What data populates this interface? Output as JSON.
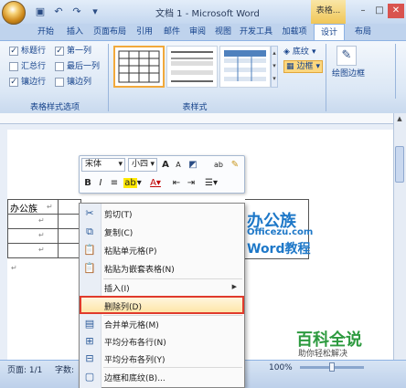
{
  "window": {
    "title": "文档 1 - Microsoft Word",
    "table_tools": "表格...",
    "minimize": "–",
    "maximize": "□",
    "close": "✕"
  },
  "tabs": [
    {
      "label": "开始"
    },
    {
      "label": "插入"
    },
    {
      "label": "页面布局"
    },
    {
      "label": "引用"
    },
    {
      "label": "邮件"
    },
    {
      "label": "审阅"
    },
    {
      "label": "视图"
    },
    {
      "label": "开发工具"
    },
    {
      "label": "加载项"
    },
    {
      "label": "设计"
    },
    {
      "label": "布局"
    }
  ],
  "ribbon": {
    "options": {
      "header_row": "标题行",
      "first_column": "第一列",
      "total_row": "汇总行",
      "last_column": "最后一列",
      "banded_rows": "镶边行",
      "banded_columns": "镶边列",
      "group_label": "表格样式选项"
    },
    "styles_group_label": "表样式",
    "shading": "底纹",
    "borders": "边框",
    "draw_borders": "绘图边框"
  },
  "document": {
    "cell_text": "办公族",
    "cell_mark": "↵",
    "para_mark": "↵"
  },
  "mini_toolbar": {
    "font": "宋体",
    "size": "小四",
    "grow": "A",
    "shrink": "A",
    "phonetic": "ab",
    "bold": "B",
    "italic": "I",
    "font_color": "A"
  },
  "context_menu": {
    "items": [
      {
        "label": "剪切(T)",
        "icon": "scissors-icon"
      },
      {
        "label": "复制(C)",
        "icon": "copy-icon"
      },
      {
        "label": "粘贴单元格(P)",
        "icon": "paste-icon"
      },
      {
        "label": "粘贴为嵌套表格(N)",
        "icon": "paste-nested-icon"
      },
      {
        "label": "插入(I)",
        "icon": ""
      },
      {
        "label": "删除列(D)",
        "icon": ""
      },
      {
        "label": "合并单元格(M)",
        "icon": "merge-icon"
      },
      {
        "label": "平均分布各行(N)",
        "icon": "distribute-rows-icon"
      },
      {
        "label": "平均分布各列(Y)",
        "icon": "distribute-cols-icon"
      },
      {
        "label": "边框和底纹(B)...",
        "icon": "borders-icon"
      }
    ],
    "submenu_arrow": "▶"
  },
  "status": {
    "page": "页面: 1/1",
    "words": "字数:",
    "zoom": "100%"
  },
  "watermark": {
    "brand_cn": "办公族",
    "brand_url": "Officezu.com",
    "brand_sub": "Word教程",
    "baike": "百科全说",
    "baike_sub": "助你轻松解决"
  }
}
